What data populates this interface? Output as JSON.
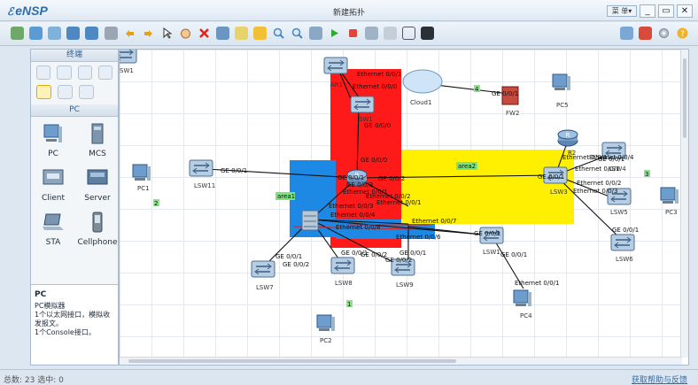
{
  "app": {
    "logo": "eNSP",
    "doc_title": "新建拓扑",
    "menu_label": "菜 单▾"
  },
  "window_controls": {
    "minimize": "_",
    "restore": "▭",
    "close": "✕"
  },
  "toolbar": {
    "buttons": [
      "new-topology",
      "open",
      "save-template",
      "save",
      "save-as",
      "print",
      "undo",
      "redo",
      "select",
      "pan",
      "delete",
      "clear-links",
      "text-note",
      "palette",
      "zoom-in",
      "zoom-out",
      "fit",
      "start-all",
      "stop-all",
      "capture",
      "settings",
      "show-labels",
      "terminal"
    ]
  },
  "left_panel": {
    "terminal_title": "终端",
    "pc_title": "PC",
    "devices": [
      {
        "label": "PC",
        "icon": "pc-icon"
      },
      {
        "label": "MCS",
        "icon": "mcs-icon"
      },
      {
        "label": "Client",
        "icon": "client-icon"
      },
      {
        "label": "Server",
        "icon": "server-icon"
      },
      {
        "label": "STA",
        "icon": "sta-laptop-icon"
      },
      {
        "label": "Cellphone",
        "icon": "cellphone-icon"
      }
    ],
    "info": {
      "title": "PC",
      "lines": [
        "PC模拟器",
        "1个以太网接口，模拟收",
        "发报文。",
        "1个Console接口。"
      ]
    }
  },
  "canvas": {
    "areas": [
      {
        "label": "area1",
        "color": "#1e88e5"
      },
      {
        "label": "area2",
        "color": "#ffef00"
      },
      {
        "label": "",
        "color": "#ff1a1a"
      }
    ],
    "notes": [
      "1",
      "2",
      "3",
      "4"
    ],
    "devices": [
      {
        "name": "SW1",
        "type": "switch"
      },
      {
        "name": "AR1",
        "type": "router"
      },
      {
        "name": "Cloud1",
        "type": "cloud"
      },
      {
        "name": "FW2",
        "type": "firewall"
      },
      {
        "name": "PC5",
        "type": "pc"
      },
      {
        "name": "SW1",
        "type": "switch"
      },
      {
        "name": "R2",
        "type": "router"
      },
      {
        "name": "LSW4",
        "type": "switch"
      },
      {
        "name": "LSW3",
        "type": "switch"
      },
      {
        "name": "LSW5",
        "type": "switch"
      },
      {
        "name": "PC3",
        "type": "pc"
      },
      {
        "name": "PC1",
        "type": "pc"
      },
      {
        "name": "LSW11",
        "type": "switch"
      },
      {
        "name": "R",
        "type": "router"
      },
      {
        "name": "LSW1",
        "type": "switch"
      },
      {
        "name": "LSW6",
        "type": "switch"
      },
      {
        "name": "LSW7",
        "type": "switch"
      },
      {
        "name": "LSW8",
        "type": "switch"
      },
      {
        "name": "LSW9",
        "type": "switch"
      },
      {
        "name": "PC4",
        "type": "pc"
      },
      {
        "name": "PC2",
        "type": "pc"
      }
    ],
    "port_labels": [
      "Ethernet 0/0/1",
      "Ethernet 0/0/0",
      "GE 0/0/1",
      "GE 0/0/0",
      "GE 0/0/0",
      "GE 0/0/1",
      "GE 0/0/1",
      "GE 0/0/2",
      "GE 0/0/3",
      "GE 0/0/1",
      "Ethernet 0/0/1",
      "Ethernet 0/0/2",
      "Ethernet 0/0/1",
      "Ethernet 0/0/3",
      "Ethernet 0/0/7",
      "Ethernet 0/0/6",
      "Ethernet 0/0/4",
      "Ethernet 0/0/8",
      "GE 0/0/1",
      "GE 0/0/2",
      "GE 0/0/1",
      "GE 0/0/2",
      "GE 0/0/1",
      "GE 0/0/2",
      "GE 0/0/1",
      "Ethernet 0/0/1",
      "Ethernet 0/0/1",
      "GE 0/0/1",
      "Ethernet 0/0/1",
      "Ethernet 0/0/4",
      "Ethernet 0/0/2",
      "Ethernet 0/0/3",
      "GE 0/0/1",
      "GE 0/0/1"
    ]
  },
  "status": {
    "left": "总数: 23 选中: 0",
    "right": "获取帮助与反馈"
  }
}
